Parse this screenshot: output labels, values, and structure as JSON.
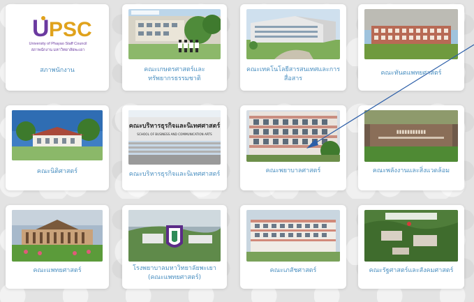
{
  "cards": [
    {
      "label": "สภาพนักงาน",
      "logo": {
        "text": "UPSC",
        "sub1": "University of Phayao Staff Council",
        "sub2": "สภาพนักงาน มหาวิทยาลัยพะเยา"
      }
    },
    {
      "label": "คณะเกษตรศาสตร์และ",
      "label2": "ทรัพยากรธรรมชาติ"
    },
    {
      "label": "คณะเทคโนโลยีสารสนเทศและการ",
      "label2": "สื่อสาร"
    },
    {
      "label": "คณะทันตแพทยศาสตร์"
    },
    {
      "label": "คณะนิติศาสตร์"
    },
    {
      "label": "คณะบริหารธุรกิจและนิเทศศาสตร์",
      "sign": {
        "thai": "คณะบริหารธุรกิจและนิเทศศาสตร์",
        "eng": "SCHOOL OF BUSINESS AND COMMUNICATION ARTS"
      }
    },
    {
      "label": "คณะพยาบาลศาสตร์"
    },
    {
      "label": "คณะพลังงานและสิ่งแวดล้อม"
    },
    {
      "label": "คณะแพทยศาสตร์"
    },
    {
      "label": "โรงพยาบาลมหาวิทยาลัยพะเยา",
      "label2": "(คณะแพทยศาสตร์)"
    },
    {
      "label": "คณะเภสัชศาสตร์"
    },
    {
      "label": "คณะรัฐศาสตร์และสังคมศาสตร์"
    }
  ],
  "colors": {
    "caption": "#4a8fc0",
    "pointer": "#2d5fa8",
    "logo_purple": "#6b3aa0",
    "logo_gold": "#e0a21c"
  }
}
